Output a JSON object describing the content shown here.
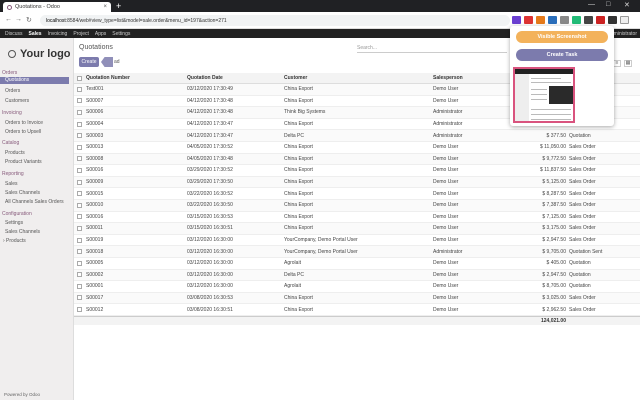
{
  "browser": {
    "tab_title": "Quotations - Odoo",
    "tab_close": "×",
    "new_tab": "+",
    "url_host": "localhost",
    "url_rest": ":8584/web#view_type=list&model=sale.order&menu_id=197&action=271",
    "window_controls": [
      "—",
      "□",
      "✕"
    ]
  },
  "odoo_nav": {
    "menus": [
      "Discuss",
      "Sales",
      "Invoicing",
      "Project",
      "Apps",
      "Settings"
    ],
    "active": "Sales",
    "user": "Administrator"
  },
  "sidebar": {
    "logo": "Your logo",
    "sections": [
      {
        "title": "Orders",
        "items": [
          "Quotations",
          "Orders",
          "Customers"
        ]
      },
      {
        "title": "Invoicing",
        "items": [
          "Orders to Invoice",
          "Orders to Upsell"
        ]
      },
      {
        "title": "Catalog",
        "items": [
          "Products",
          "Product Variants"
        ]
      },
      {
        "title": "Reporting",
        "items": [
          "Sales",
          "Sales Channels",
          "All Channels Sales Orders"
        ]
      },
      {
        "title": "Configuration",
        "items": [
          "Settings",
          "Sales Channels",
          "› Products"
        ]
      }
    ],
    "active_item": "Quotations",
    "powered_by": "Powered by Odoo"
  },
  "main": {
    "breadcrumb": "Quotations",
    "search_placeholder": "Search...",
    "create_label": "Create",
    "upload_label": "ad"
  },
  "table": {
    "headers": [
      "Quotation Number",
      "Quotation Date",
      "Customer",
      "Salesperson"
    ],
    "rows": [
      {
        "num": "Test001",
        "date": "03/12/2020 17:30:49",
        "customer": "China Export",
        "sales": "Demo User",
        "total": "",
        "status": ""
      },
      {
        "num": "S00007",
        "date": "04/12/2020 17:30:48",
        "customer": "China Export",
        "sales": "Demo User",
        "total": "",
        "status": ""
      },
      {
        "num": "S00006",
        "date": "04/12/2020 17:30:48",
        "customer": "Think Big Systems",
        "sales": "Administrator",
        "total": "",
        "status": ""
      },
      {
        "num": "S00004",
        "date": "04/12/2020 17:30:47",
        "customer": "China Export",
        "sales": "Administrator",
        "total": "$ 2,240.00",
        "status": "Sales Order"
      },
      {
        "num": "S00003",
        "date": "04/12/2020 17:30:47",
        "customer": "Delta PC",
        "sales": "Administrator",
        "total": "$ 377.50",
        "status": "Quotation"
      },
      {
        "num": "S00013",
        "date": "04/05/2020 17:30:52",
        "customer": "China Export",
        "sales": "Demo User",
        "total": "$ 11,050.00",
        "status": "Sales Order"
      },
      {
        "num": "S00008",
        "date": "04/05/2020 17:30:48",
        "customer": "China Export",
        "sales": "Demo User",
        "total": "$ 9,772.50",
        "status": "Sales Order"
      },
      {
        "num": "S00016",
        "date": "03/29/2020 17:30:52",
        "customer": "China Export",
        "sales": "Demo User",
        "total": "$ 11,837.50",
        "status": "Sales Order"
      },
      {
        "num": "S00009",
        "date": "03/29/2020 17:30:50",
        "customer": "China Export",
        "sales": "Demo User",
        "total": "$ 5,125.00",
        "status": "Sales Order"
      },
      {
        "num": "S00015",
        "date": "03/22/2020 16:30:52",
        "customer": "China Export",
        "sales": "Demo User",
        "total": "$ 8,287.50",
        "status": "Sales Order"
      },
      {
        "num": "S00010",
        "date": "03/22/2020 16:30:50",
        "customer": "China Export",
        "sales": "Demo User",
        "total": "$ 7,387.50",
        "status": "Sales Order"
      },
      {
        "num": "S00016",
        "date": "03/15/2020 16:30:53",
        "customer": "China Export",
        "sales": "Demo User",
        "total": "$ 7,125.00",
        "status": "Sales Order"
      },
      {
        "num": "S00011",
        "date": "03/15/2020 16:30:51",
        "customer": "China Export",
        "sales": "Demo User",
        "total": "$ 3,175.00",
        "status": "Sales Order"
      },
      {
        "num": "S00019",
        "date": "03/12/2020 16:30:00",
        "customer": "YourCompany, Demo Portal User",
        "sales": "Demo User",
        "total": "$ 2,947.50",
        "status": "Sales Order"
      },
      {
        "num": "S00018",
        "date": "03/12/2020 16:30:00",
        "customer": "YourCompany, Demo Portal User",
        "sales": "Administrator",
        "total": "$ 9,705.00",
        "status": "Quotation Sent"
      },
      {
        "num": "S00005",
        "date": "03/12/2020 16:30:00",
        "customer": "Agrolait",
        "sales": "Demo User",
        "total": "$ 405.00",
        "status": "Quotation"
      },
      {
        "num": "S00002",
        "date": "03/12/2020 16:30:00",
        "customer": "Delta PC",
        "sales": "Demo User",
        "total": "$ 2,947.50",
        "status": "Quotation"
      },
      {
        "num": "S00001",
        "date": "03/12/2020 16:30:00",
        "customer": "Agrolait",
        "sales": "Demo User",
        "total": "$ 8,705.00",
        "status": "Quotation"
      },
      {
        "num": "S00017",
        "date": "03/08/2020 16:30:53",
        "customer": "China Export",
        "sales": "Demo User",
        "total": "$ 3,025.00",
        "status": "Sales Order"
      },
      {
        "num": "S00012",
        "date": "03/08/2020 16:30:51",
        "customer": "China Export",
        "sales": "Demo User",
        "total": "$ 2,962.50",
        "status": "Sales Order"
      }
    ],
    "footer_total": "124,021.00"
  },
  "popup": {
    "visible_screenshot": "Visible Screenshot",
    "create_task": "Create Task"
  },
  "colors": {
    "odoo_primary": "#7c7bad",
    "orange_button": "#f3b25b",
    "thumb_border": "#d9537e"
  }
}
